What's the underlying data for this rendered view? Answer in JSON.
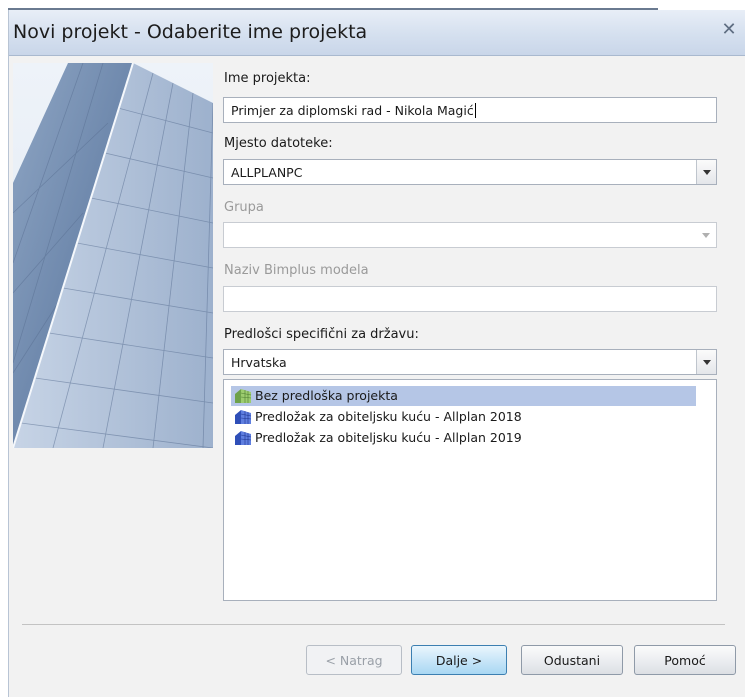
{
  "window": {
    "title": "Novi projekt - Odaberite ime projekta",
    "close_icon": "close-icon"
  },
  "form": {
    "project_name": {
      "label": "Ime projekta:",
      "value": "Primjer za diplomski rad - Nikola Magić"
    },
    "file_location": {
      "label": "Mjesto datoteke:",
      "value": "ALLPLANPC"
    },
    "group": {
      "label": "Grupa",
      "value": ""
    },
    "bimplus_model": {
      "label": "Naziv Bimplus modela",
      "value": ""
    },
    "country_templates": {
      "label": "Predlošci specifični za državu:",
      "value": "Hrvatska"
    }
  },
  "templates": {
    "items": [
      {
        "label": "Bez predloška projekta",
        "icon": "green-building-icon",
        "selected": true
      },
      {
        "label": "Predložak za obiteljsku kuću - Allplan 2018",
        "icon": "blue-building-icon",
        "selected": false
      },
      {
        "label": "Predložak za obiteljsku kuću - Allplan 2019",
        "icon": "blue-building-icon",
        "selected": false
      }
    ]
  },
  "buttons": {
    "back": "< Natrag",
    "next": "Dalje >",
    "cancel": "Odustani",
    "help": "Pomoć"
  },
  "colors": {
    "titlebar": "#d5e0ef",
    "selection": "#b5c6e6",
    "primary_button": "#c9e6f8"
  }
}
